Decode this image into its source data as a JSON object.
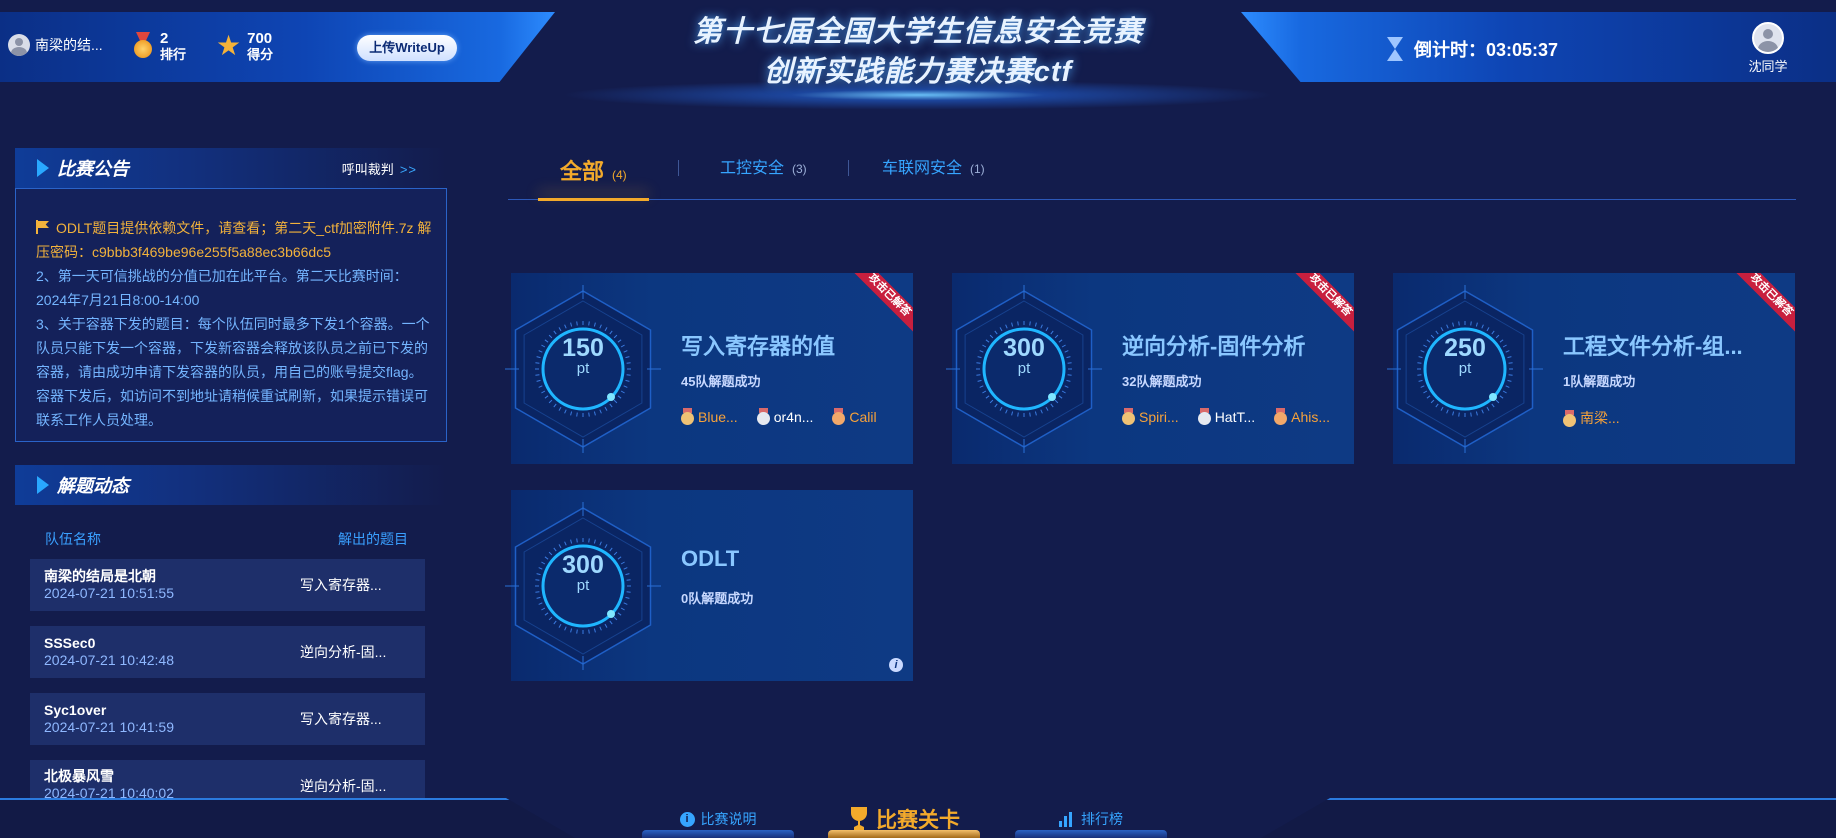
{
  "header": {
    "team_name": "南梁的结...",
    "rank_value": "2",
    "rank_label": "排行",
    "score_value": "700",
    "score_label": "得分",
    "upload_button": "上传WriteUp",
    "title_line1": "第十七届全国大学生信息安全竞赛",
    "title_line2": "创新实践能力赛决赛ctf",
    "countdown_label": "倒计时：",
    "countdown_value": "03:05:37",
    "user_name": "沈同学"
  },
  "notice": {
    "title": "比赛公告",
    "call_referee": "呼叫裁判",
    "call_arrow": ">>",
    "item1": "ODLT题目提供依赖文件，请查看；第二天_ctf加密附件.7z 解压密码：c9bbb3f469be96e255f5a88ec3b66dc5",
    "item2": "2、第一天可信挑战的分值已加在此平台。第二天比赛时间：2024年7月21日8:00-14:00",
    "item3": "3、关于容器下发的题目：每个队伍同时最多下发1个容器。一个队员只能下发一个容器，下发新容器会释放该队员之前已下发的容器，请由成功申请下发容器的队员，用自己的账号提交flag。容器下发后，如访问不到地址请稍候重试刷新，如果提示错误可联系工作人员处理。"
  },
  "solves": {
    "title": "解题动态",
    "col_team": "队伍名称",
    "col_chal": "解出的题目",
    "rows": [
      {
        "team": "南梁的结局是北朝",
        "time": "2024-07-21 10:51:55",
        "chal": "写入寄存器..."
      },
      {
        "team": "SSSec0",
        "time": "2024-07-21 10:42:48",
        "chal": "逆向分析-固..."
      },
      {
        "team": "Syc1over",
        "time": "2024-07-21 10:41:59",
        "chal": "写入寄存器..."
      },
      {
        "team": "北极暴风雪",
        "time": "2024-07-21 10:40:02",
        "chal": "逆向分析-固..."
      }
    ]
  },
  "tabs": [
    {
      "label": "全部",
      "count": "(4)",
      "active": true
    },
    {
      "label": "工控安全",
      "count": "(3)"
    },
    {
      "label": "车联网安全",
      "count": "(1)"
    }
  ],
  "cards": [
    {
      "name": "写入寄存器的值",
      "points": "150",
      "unit": "pt",
      "solved": "45队解题成功",
      "ribbon": "攻击已解答",
      "solvers": [
        {
          "rank": "gold",
          "name": "Blue..."
        },
        {
          "rank": "silver",
          "name": "or4n..."
        },
        {
          "rank": "bronze",
          "name": "Calil"
        }
      ]
    },
    {
      "name": "逆向分析-固件分析",
      "points": "300",
      "unit": "pt",
      "solved": "32队解题成功",
      "ribbon": "攻击已解答",
      "solvers": [
        {
          "rank": "gold",
          "name": "Spiri..."
        },
        {
          "rank": "silver",
          "name": "HatT..."
        },
        {
          "rank": "bronze",
          "name": "Ahis..."
        }
      ]
    },
    {
      "name": "工程文件分析-组...",
      "points": "250",
      "unit": "pt",
      "solved": "1队解题成功",
      "ribbon": "攻击已解答",
      "solvers": [
        {
          "rank": "gold",
          "name": "南梁..."
        }
      ]
    },
    {
      "name": "ODLT",
      "points": "300",
      "unit": "pt",
      "solved": "0队解题成功",
      "info": "i"
    }
  ],
  "footer": {
    "rules": "比赛说明",
    "levels": "比赛关卡",
    "leaderboard": "排行榜"
  },
  "colors": {
    "background": "#131c4c",
    "accent_orange": "#f3aa2b",
    "accent_blue": "#36a5ff",
    "ribbon_red": "#c81f3e"
  }
}
